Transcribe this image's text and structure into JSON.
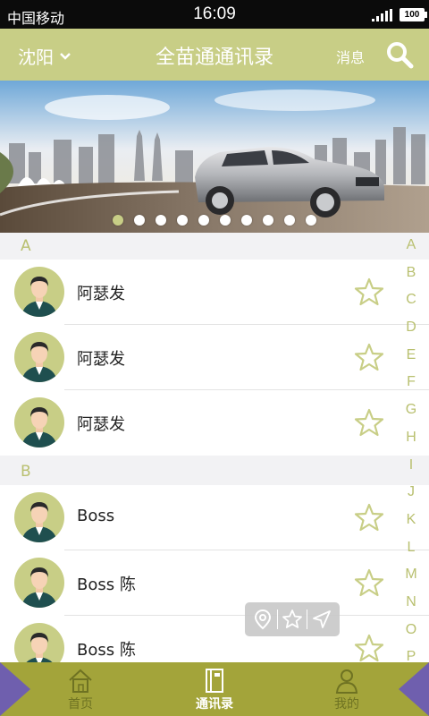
{
  "status_bar": {
    "carrier": "中国移动",
    "time": "16:09",
    "battery": "100"
  },
  "header": {
    "city": "沈阳",
    "title": "全苗通通讯录",
    "messages_label": "消息",
    "accent_color": "#c8ce86"
  },
  "banner": {
    "image_subject": "silver sedan on a city highway",
    "dot_count": 10,
    "active_dot": 0
  },
  "sections": [
    {
      "letter": "A",
      "contacts": [
        {
          "name": "阿瑟发"
        },
        {
          "name": "阿瑟发"
        },
        {
          "name": "阿瑟发"
        }
      ]
    },
    {
      "letter": "B",
      "contacts": [
        {
          "name": "Boss"
        },
        {
          "name": "Boss 陈"
        },
        {
          "name": "Boss 陈"
        }
      ]
    }
  ],
  "index_letters": [
    "A",
    "B",
    "C",
    "D",
    "E",
    "F",
    "G",
    "H",
    "I",
    "J",
    "K",
    "L",
    "M",
    "N",
    "O",
    "P"
  ],
  "action_pill": {
    "icons": [
      "location-pin-icon",
      "star-icon",
      "send-icon"
    ]
  },
  "tabs": [
    {
      "label": "首页",
      "icon": "house-icon",
      "active": false
    },
    {
      "label": "通讯录",
      "icon": "address-book-icon",
      "active": true
    },
    {
      "label": "我的",
      "icon": "person-icon",
      "active": false
    }
  ]
}
